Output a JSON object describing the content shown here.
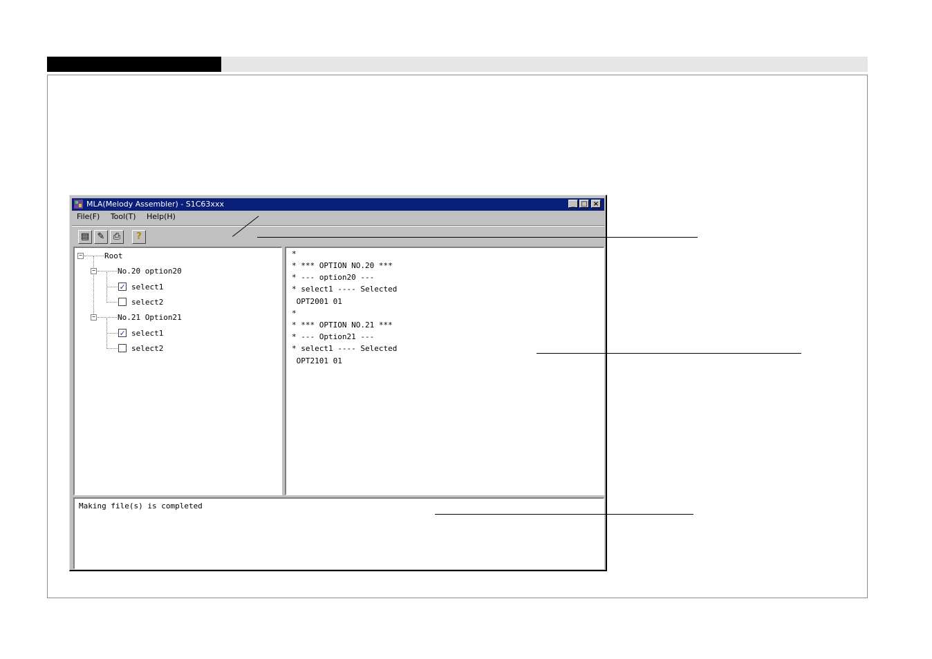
{
  "window": {
    "title": "MLA(Melody Assembler) - S1C63xxx",
    "buttons": {
      "minimize": "_",
      "maximize": "□",
      "close": "×"
    }
  },
  "menu": {
    "items": [
      "File(F)",
      "Tool(T)",
      "Help(H)"
    ]
  },
  "toolbar": {
    "buttons": [
      {
        "icon": "make-file-icon",
        "glyph": "▤"
      },
      {
        "icon": "edit-icon",
        "glyph": "✎"
      },
      {
        "icon": "print-icon",
        "glyph": "⎙"
      },
      {
        "icon": "help-icon",
        "glyph": "?"
      }
    ]
  },
  "tree": {
    "root": "Root",
    "options": [
      {
        "label": "No.20 option20",
        "children": [
          {
            "label": "select1",
            "checked": true
          },
          {
            "label": "select2",
            "checked": false
          }
        ]
      },
      {
        "label": "No.21 Option21",
        "children": [
          {
            "label": "select1",
            "checked": true
          },
          {
            "label": "select2",
            "checked": false
          }
        ]
      }
    ]
  },
  "output_lines": [
    "*",
    "* *** OPTION NO.20 ***",
    "* --- option20 ---",
    "* select1 ---- Selected",
    " OPT2001 01",
    "*",
    "* *** OPTION NO.21 ***",
    "* --- Option21 ---",
    "* select1 ---- Selected",
    " OPT2101 01"
  ],
  "message": "Making file(s) is completed",
  "colors": {
    "titlebar": "#0a1f7a",
    "window_face": "#c0c0c0",
    "check": "#1a2bb0"
  }
}
